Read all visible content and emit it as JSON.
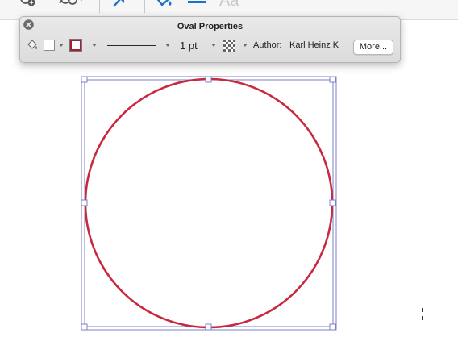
{
  "toolbar": {
    "icons": [
      "shape-add-icon",
      "shape-settings-icon",
      "pin-icon",
      "paint-bucket-icon",
      "line-weight-icon",
      "text-style-icon"
    ],
    "text_style_label": "Aa"
  },
  "palette": {
    "title": "Oval Properties",
    "line_weight": "1 pt",
    "author_label": "Author:",
    "author_name": "Karl Heinz K",
    "more_label": "More..."
  },
  "shape": {
    "type": "oval",
    "stroke_color": "#c8293f",
    "fill_color": "none",
    "selection_color": "#7b7fc9"
  }
}
